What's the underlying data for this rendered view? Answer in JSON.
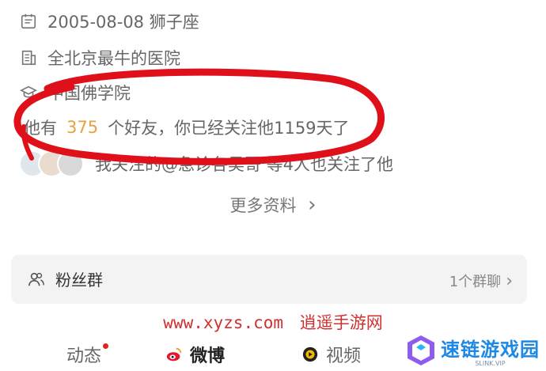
{
  "profile": {
    "birthday": "2005-08-08 狮子座",
    "school": "全北京最牛的医院",
    "college": "中国佛学院",
    "friends_prefix": "他有",
    "friends_count": "375",
    "friends_suffix": "个好友，你已经关注他1159天了",
    "mutual": "我关注的@急诊各吴哥 等4人也关注了他",
    "more_label": "更多资料",
    "more_chevron": "›"
  },
  "fan_group": {
    "label": "粉丝群",
    "count": "1个群聊",
    "chevron": "›"
  },
  "watermark": {
    "url": "www.xyzs.com",
    "site": "逍遥手游网"
  },
  "tabs": [
    {
      "label": "动态",
      "has_dot": true
    },
    {
      "label": "微博",
      "active": true
    },
    {
      "label": "视频"
    }
  ],
  "logo": {
    "name": "速链游戏园",
    "sub": "SLINK.VIP"
  },
  "colors": {
    "accent_count": "#e6a23c",
    "annotation": "#e0101a",
    "watermark": "#d03030",
    "logo": "#1e88e5"
  }
}
